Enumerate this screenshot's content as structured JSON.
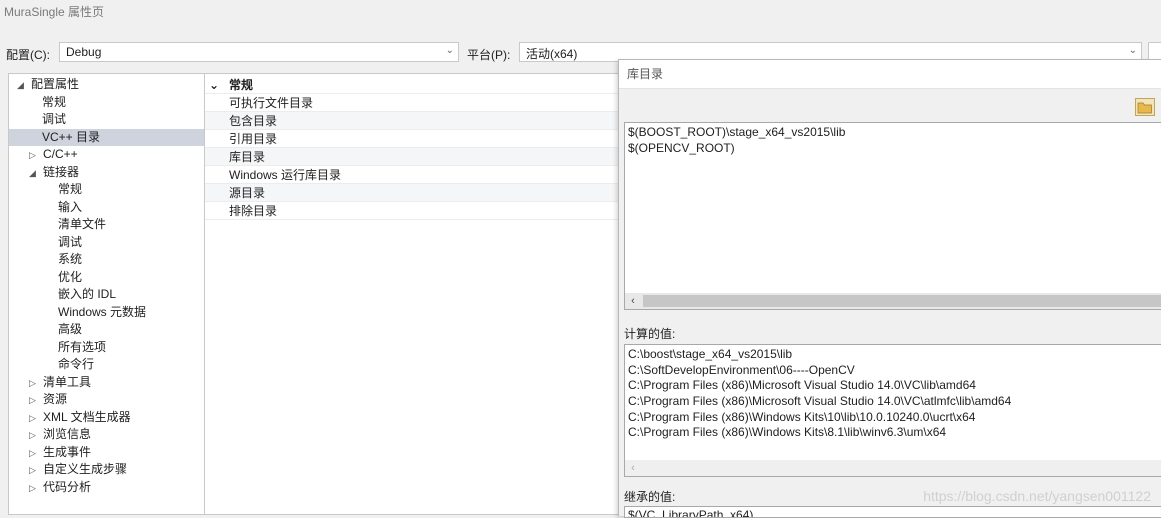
{
  "window": {
    "title": "MuraSingle 属性页"
  },
  "toolbar": {
    "config_label": "配置(C):",
    "config_value": "Debug",
    "platform_label": "平台(P):",
    "platform_value": "活动(x64)"
  },
  "tree": {
    "items": [
      {
        "label": "配置属性",
        "expander": "◢"
      },
      {
        "label": "常规"
      },
      {
        "label": "调试"
      },
      {
        "label": "VC++ 目录",
        "selected": true
      },
      {
        "label": "C/C++",
        "expander": "▷"
      },
      {
        "label": "链接器",
        "expander": "◢"
      },
      {
        "label": "常规"
      },
      {
        "label": "输入"
      },
      {
        "label": "清单文件"
      },
      {
        "label": "调试"
      },
      {
        "label": "系统"
      },
      {
        "label": "优化"
      },
      {
        "label": "嵌入的 IDL"
      },
      {
        "label": "Windows 元数据"
      },
      {
        "label": "高级"
      },
      {
        "label": "所有选项"
      },
      {
        "label": "命令行"
      },
      {
        "label": "清单工具",
        "expander": "▷"
      },
      {
        "label": "资源",
        "expander": "▷"
      },
      {
        "label": "XML 文档生成器",
        "expander": "▷"
      },
      {
        "label": "浏览信息",
        "expander": "▷"
      },
      {
        "label": "生成事件",
        "expander": "▷"
      },
      {
        "label": "自定义生成步骤",
        "expander": "▷"
      },
      {
        "label": "代码分析",
        "expander": "▷"
      }
    ]
  },
  "grid": {
    "category": "常规",
    "category_expander": "⌄",
    "rows": [
      {
        "label": "可执行文件目录"
      },
      {
        "label": "包含目录"
      },
      {
        "label": "引用目录"
      },
      {
        "label": "库目录"
      },
      {
        "label": "Windows 运行库目录"
      },
      {
        "label": "源目录"
      },
      {
        "label": "排除目录"
      }
    ]
  },
  "dialog": {
    "title": "库目录",
    "entries": [
      "$(BOOST_ROOT)\\stage_x64_vs2015\\lib",
      "$(OPENCV_ROOT)"
    ],
    "evaluated_label": "计算的值:",
    "evaluated": [
      "C:\\boost\\stage_x64_vs2015\\lib",
      "C:\\SoftDevelopEnvironment\\06----OpenCV",
      "C:\\Program Files (x86)\\Microsoft Visual Studio 14.0\\VC\\lib\\amd64",
      "C:\\Program Files (x86)\\Microsoft Visual Studio 14.0\\VC\\atlmfc\\lib\\amd64",
      "C:\\Program Files (x86)\\Windows Kits\\10\\lib\\10.0.10240.0\\ucrt\\x64",
      "C:\\Program Files (x86)\\Windows Kits\\8.1\\lib\\winv6.3\\um\\x64"
    ],
    "inherited_label": "继承的值:",
    "inherited_first": "$(VC_LibraryPath_x64)"
  },
  "watermark": "https://blog.csdn.net/yangsen001122",
  "icons": {
    "folder": "folder-icon",
    "scroll_left": "‹",
    "dropdown": "⌄"
  }
}
